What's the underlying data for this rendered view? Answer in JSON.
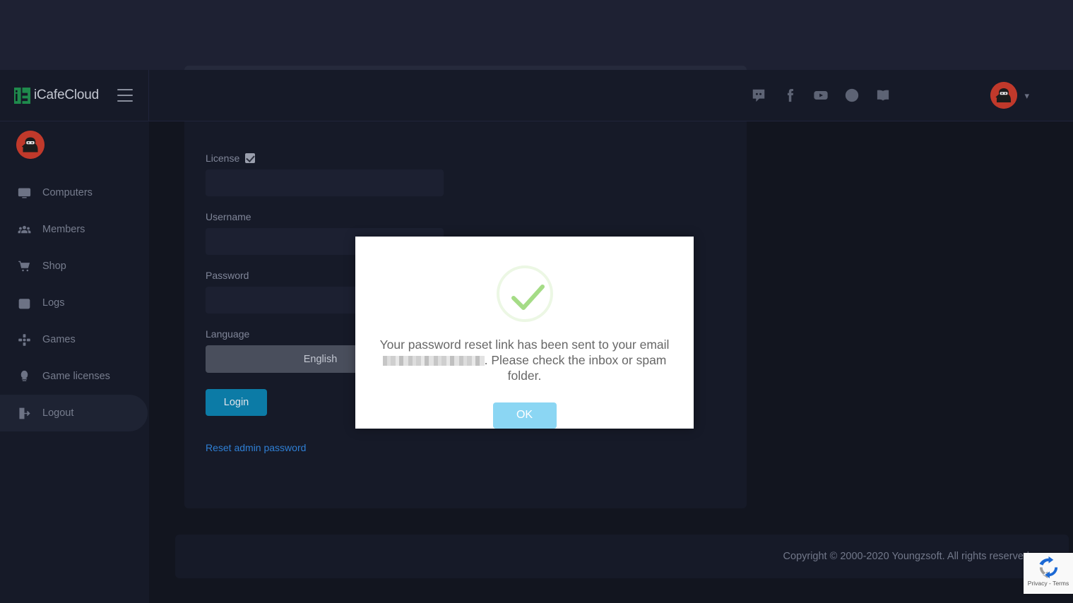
{
  "brand": {
    "name": "iCafeCloud",
    "logo_color": "#1f8a4c"
  },
  "header": {
    "menu_toggle": "hamburger-menu",
    "icons": [
      {
        "name": "discord-icon",
        "label": "Discord"
      },
      {
        "name": "facebook-icon",
        "label": "Facebook"
      },
      {
        "name": "youtube-icon",
        "label": "YouTube"
      },
      {
        "name": "globe-icon",
        "label": "Language"
      },
      {
        "name": "book-icon",
        "label": "Documentation"
      }
    ],
    "avatar": "ninja-avatar",
    "chevron": "⌄"
  },
  "sidebar": {
    "avatar": "ninja-avatar",
    "items": [
      {
        "label": "Computers",
        "icon": "monitor-icon",
        "active": false
      },
      {
        "label": "Members",
        "icon": "people-icon",
        "active": false
      },
      {
        "label": "Shop",
        "icon": "cart-icon",
        "active": false
      },
      {
        "label": "Logs",
        "icon": "calendar-icon",
        "active": false
      },
      {
        "label": "Games",
        "icon": "gamepad-icon",
        "active": false
      },
      {
        "label": "Game licenses",
        "icon": "license-icon",
        "active": false
      },
      {
        "label": "Logout",
        "icon": "logout-icon",
        "active": true
      }
    ]
  },
  "login_form": {
    "license_label": "License",
    "license_checked": true,
    "license_value": "",
    "license_placeholder": "",
    "username_label": "Username",
    "username_value": "",
    "username_placeholder": "",
    "password_label": "Password",
    "password_value": "",
    "password_placeholder": "",
    "language_label": "Language",
    "language_selected": "English",
    "language_options": [
      "English"
    ],
    "login_button": "Login",
    "reset_link": "Reset admin password"
  },
  "modal": {
    "icon": "success-check-icon",
    "message_before": "Your password reset link has been sent to your email ",
    "message_after": ". Please check the inbox or spam folder.",
    "email_redacted": true,
    "ok_button": "OK",
    "accent_color": "#8bd6f3",
    "check_color": "#a5dc86"
  },
  "footer": {
    "copyright": "Copyright © 2000-2020 Youngzsoft. All rights reserved."
  },
  "recaptcha": {
    "text": "Privacy - Terms"
  }
}
